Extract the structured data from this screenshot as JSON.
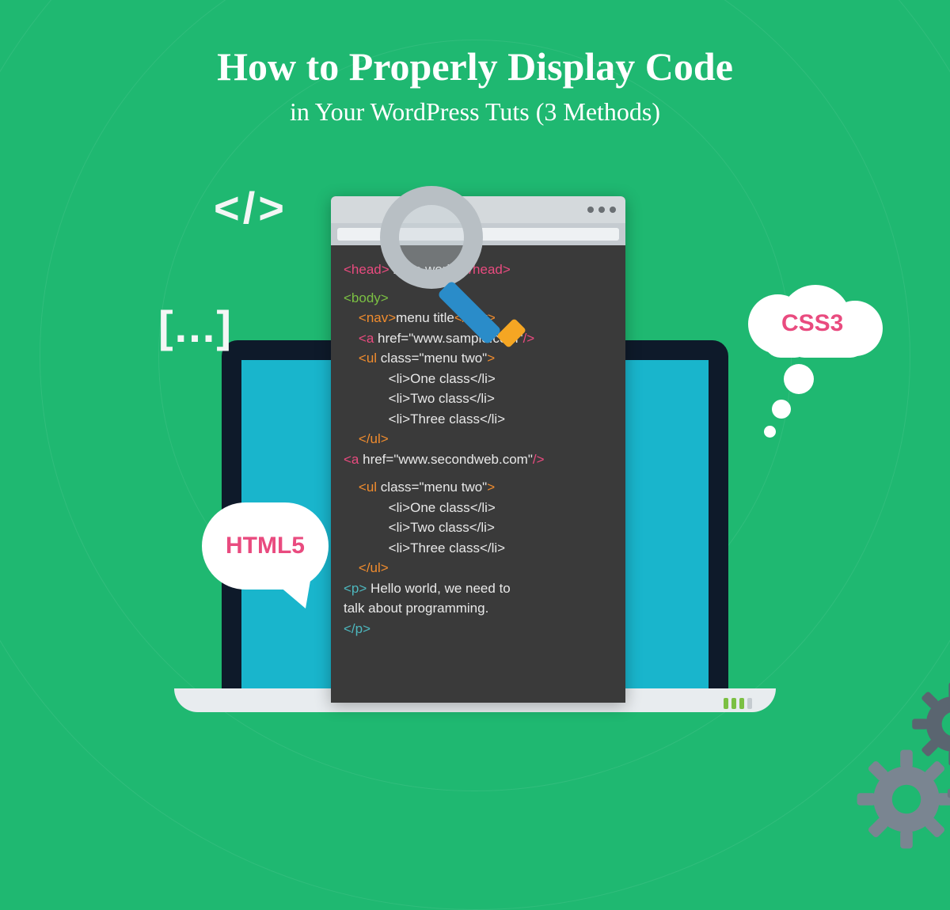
{
  "header": {
    "title": "How to Properly Display Code",
    "subtitle": "in Your WordPress Tuts (3 Methods)"
  },
  "decor": {
    "tag": "</>",
    "brackets": "[...]"
  },
  "bubbles": {
    "html": "HTML5",
    "css": "CSS3"
  },
  "code": {
    "l1a": "<head>",
    "l1b": " hello world ",
    "l1c": "</head>",
    "l2": "<body>",
    "l3a": "    <nav>",
    "l3b": "menu title",
    "l3c": "</nav>",
    "l4a": "    <a",
    "l4b": " href=\"www.sample.com\"",
    "l4c": "/>",
    "l5a": "    <ul",
    "l5b": " class=\"menu two\"",
    "l5c": ">",
    "l6a": "            <li>",
    "l6b": "One class",
    "l6c": "</li>",
    "l7a": "            <li>",
    "l7b": "Two class",
    "l7c": "</li>",
    "l8a": "            <li>",
    "l8b": "Three class",
    "l8c": "</li>",
    "l9": "    </ul>",
    "l10a": "<a",
    "l10b": " href=\"www.secondweb.com\"",
    "l10c": "/>",
    "l11a": "    <ul",
    "l11b": " class=\"menu two\"",
    "l11c": ">",
    "l12a": "            <li>",
    "l12b": "One class",
    "l12c": "</li>",
    "l13a": "            <li>",
    "l13b": "Two class",
    "l13c": "</li>",
    "l14a": "            <li>",
    "l14b": "Three class",
    "l14c": "</li>",
    "l15": "    </ul>",
    "l16a": "<p>",
    "l16b": " Hello world, we need to",
    "l17": "talk about programming.",
    "l18": "</p>"
  }
}
